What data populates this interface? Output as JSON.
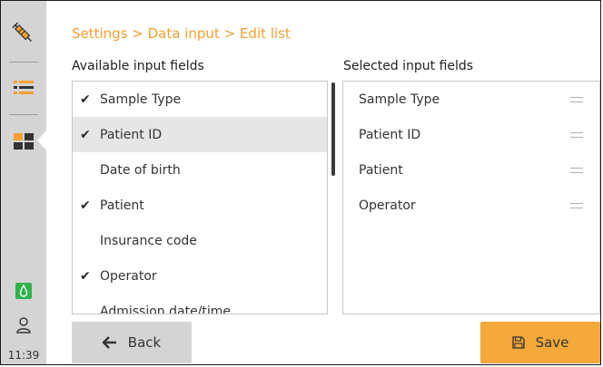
{
  "sidebar": {
    "icons": [
      "syringe-icon",
      "list-icon",
      "grid-icon",
      "drop-icon",
      "user-icon"
    ],
    "time": "11:39"
  },
  "breadcrumb": "Settings > Data input > Edit list",
  "available": {
    "title": "Available input fields",
    "items": [
      {
        "label": "Sample Type",
        "checked": true
      },
      {
        "label": "Patient ID",
        "checked": true
      },
      {
        "label": "Date of birth",
        "checked": false
      },
      {
        "label": "Patient",
        "checked": true
      },
      {
        "label": "Insurance code",
        "checked": false
      },
      {
        "label": "Operator",
        "checked": true
      },
      {
        "label": "Admission date/time",
        "checked": false
      }
    ]
  },
  "selected": {
    "title": "Selected input fields",
    "items": [
      {
        "label": "Sample Type"
      },
      {
        "label": "Patient ID"
      },
      {
        "label": "Patient"
      },
      {
        "label": "Operator"
      }
    ]
  },
  "buttons": {
    "back": "Back",
    "save": "Save"
  },
  "colors": {
    "accent": "#f0a030",
    "save_bg": "#f4a93a",
    "sidebar_bg": "#d4d4d4",
    "drop_green": "#2db34a"
  }
}
